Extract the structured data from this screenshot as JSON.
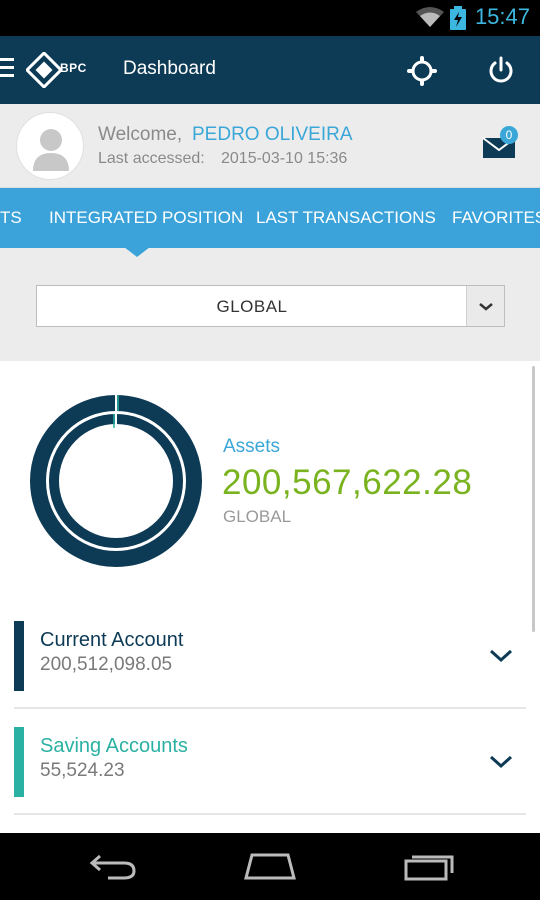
{
  "status_bar": {
    "time": "15:47"
  },
  "app_bar": {
    "logo_text": "BPC",
    "title": "Dashboard"
  },
  "user": {
    "welcome": "Welcome,",
    "name": "PEDRO OLIVEIRA",
    "last_accessed_label": "Last accessed:",
    "last_accessed_value": "2015-03-10 15:36",
    "unread_messages": "0"
  },
  "tabs": [
    "TS",
    "INTEGRATED POSITION",
    "LAST TRANSACTIONS",
    "FAVORITES"
  ],
  "filter": {
    "selected": "GLOBAL"
  },
  "summary": {
    "label": "Assets",
    "value": "200,567,622.28",
    "scope": "GLOBAL"
  },
  "accounts": [
    {
      "name": "Current Account",
      "amount": "200,512,098.05",
      "color": "#0d3a55"
    },
    {
      "name": "Saving Accounts",
      "amount": "55,524.23",
      "color": "#2bb1a3"
    }
  ],
  "colors": {
    "primary": "#0d3a55",
    "accent": "#3ba3d9",
    "positive": "#7ab320",
    "teal": "#2bb1a3"
  },
  "icons": [
    "menu-icon",
    "bpc-logo",
    "settings-icon",
    "power-icon",
    "mail-icon",
    "chevron-down-icon",
    "back-icon",
    "home-icon",
    "recent-apps-icon"
  ]
}
